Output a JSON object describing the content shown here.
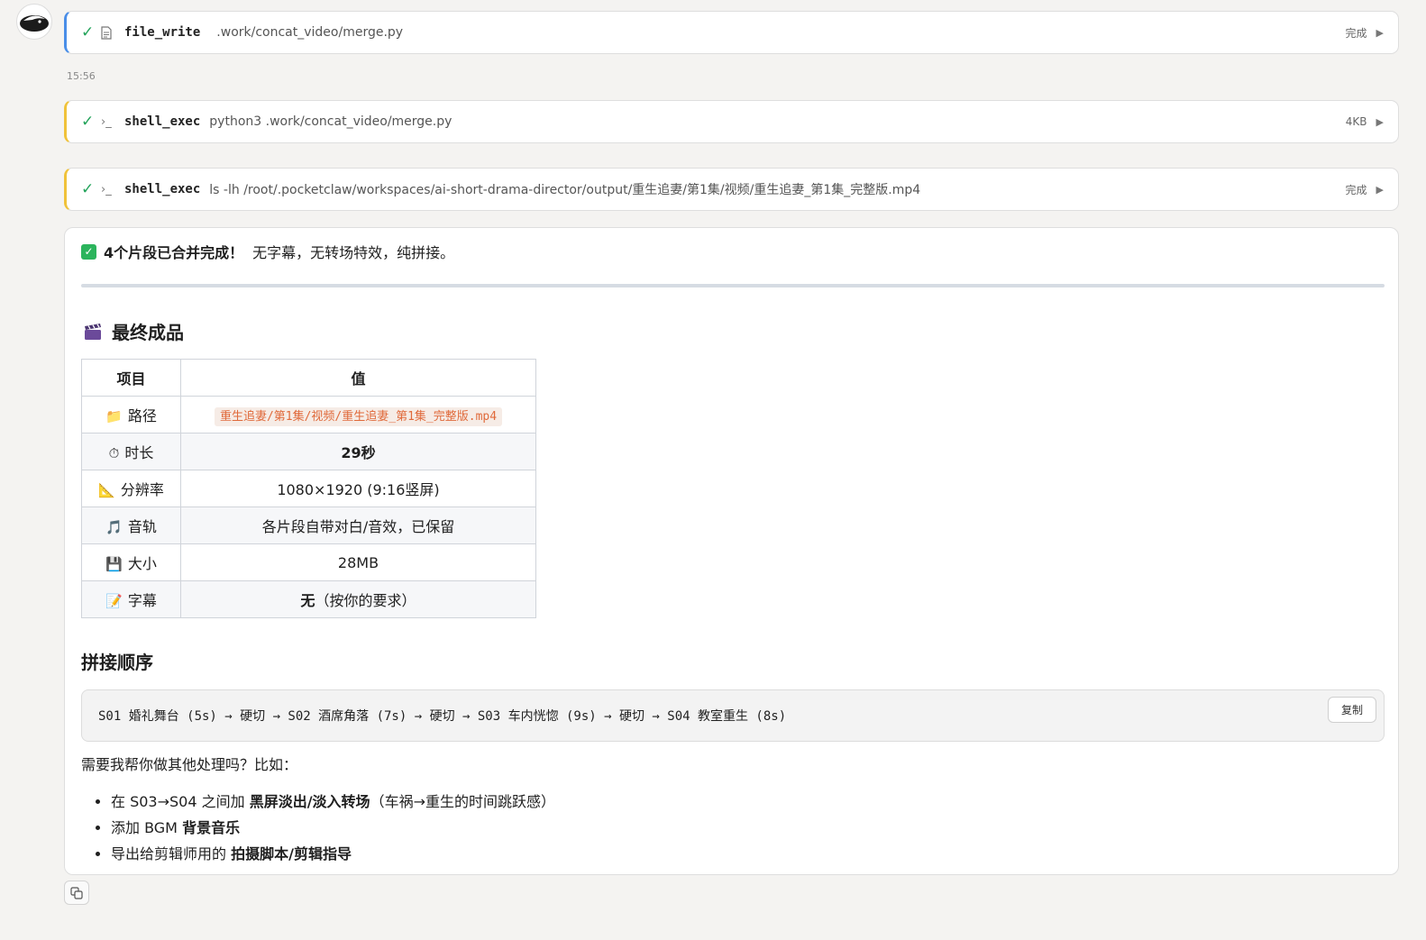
{
  "avatar": {
    "icon": "crab-claw-logo-icon"
  },
  "tools": [
    {
      "status_check": "✓",
      "name": "file_write",
      "arg": ".work/concat_video/merge.py",
      "status": "完成",
      "accent": "#4a8ee8"
    },
    {
      "status_check": "✓",
      "name": "shell_exec",
      "arg": "python3 .work/concat_video/merge.py",
      "status": "4KB",
      "accent": "#f0c23a"
    },
    {
      "status_check": "✓",
      "name": "shell_exec",
      "arg": "ls -lh /root/.pocketclaw/workspaces/ai-short-drama-director/output/重生追妻/第1集/视频/重生追妻_第1集_完整版.mp4",
      "status": "完成",
      "accent": "#f0c23a"
    }
  ],
  "timestamp": "15:56",
  "message": {
    "done_bold": "4个片段已合并完成！",
    "done_rest": "无字幕，无转场特效，纯拼接。",
    "section_title": "最终成品",
    "table": {
      "headers": [
        "项目",
        "值"
      ],
      "rows": [
        {
          "icon": "📁",
          "label": "路径",
          "value": "重生追妻/第1集/视频/重生追妻_第1集_完整版.mp4"
        },
        {
          "icon": "⏱",
          "label": "时长",
          "value": "29秒"
        },
        {
          "icon": "📐",
          "label": "分辨率",
          "value": "1080×1920 (9:16竖屏)"
        },
        {
          "icon": "🎵",
          "label": "音轨",
          "value": "各片段自带对白/音效，已保留"
        },
        {
          "icon": "💾",
          "label": "大小",
          "value": "28MB"
        },
        {
          "icon": "📝",
          "label": "字幕",
          "value_bold": "无",
          "value_rest": "（按你的要求）"
        }
      ]
    },
    "order_title": "拼接顺序",
    "order_code": "S01 婚礼舞台 (5s) → 硬切 → S02 酒席角落 (7s) → 硬切 → S03 车内恍惚 (9s) → 硬切 → S04 教室重生 (8s)",
    "copy_label": "复制",
    "ask": "需要我帮你做其他处理吗？比如：",
    "options": [
      {
        "pre": "在 S03→S04 之间加 ",
        "bold": "黑屏淡出/淡入转场",
        "post": "（车祸→重生的时间跳跃感）"
      },
      {
        "pre": "添加 BGM ",
        "bold": "背景音乐",
        "post": ""
      },
      {
        "pre": "导出给剪辑师用的 ",
        "bold": "拍摄脚本/剪辑指导",
        "post": ""
      }
    ]
  }
}
